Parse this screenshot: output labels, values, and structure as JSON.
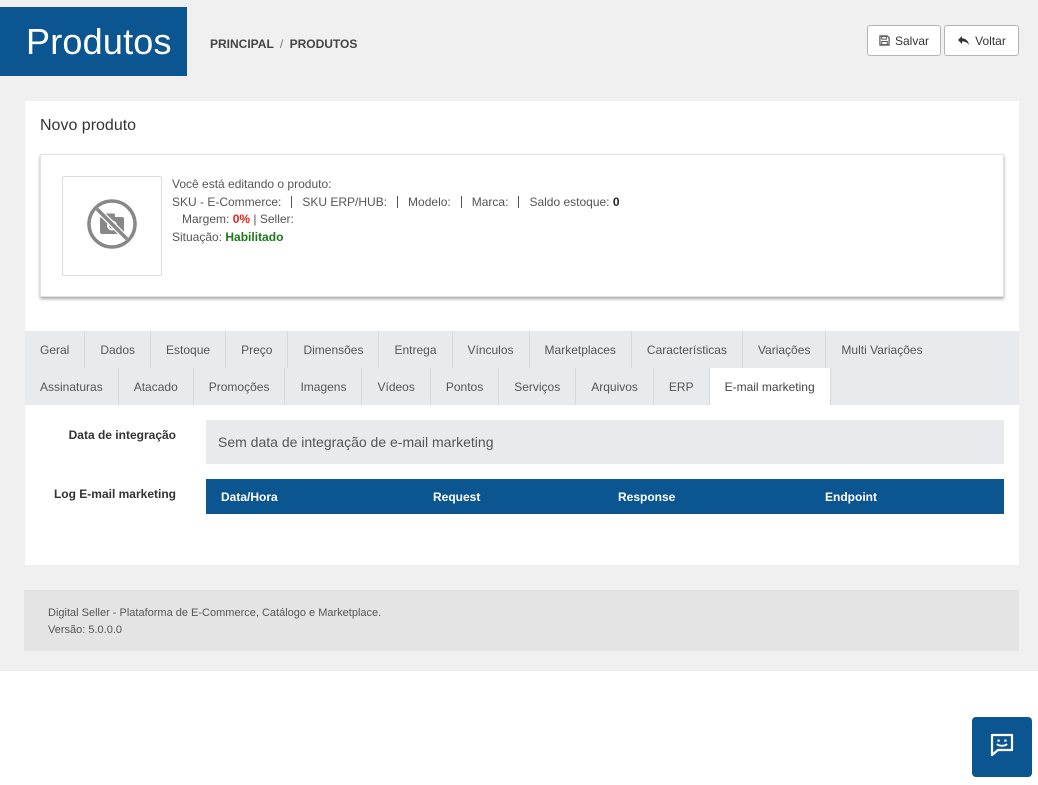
{
  "header": {
    "title": "Produtos",
    "breadcrumb": {
      "home": "PRINCIPAL",
      "separator": "/",
      "current": "PRODUTOS"
    },
    "buttons": {
      "save": "Salvar",
      "back": "Voltar"
    }
  },
  "card": {
    "title": "Novo produto",
    "product": {
      "editing_text": "Você está editando o produto:",
      "sku_ecommerce": "SKU - E-Commerce:",
      "sku_erp": "SKU ERP/HUB:",
      "modelo": "Modelo:",
      "marca": "Marca:",
      "saldo_label": "Saldo estoque:",
      "saldo_value": "0",
      "margem_label": "Margem:",
      "margem_value": "0%",
      "separator": "|",
      "seller_label": "Seller:",
      "situacao_label": "Situação:",
      "situacao_value": "Habilitado",
      "image_icon": "no-camera-icon"
    }
  },
  "tabs": {
    "row1": [
      "Geral",
      "Dados",
      "Estoque",
      "Preço",
      "Dimensões",
      "Entrega",
      "Vínculos",
      "Marketplaces",
      "Características",
      "Variações",
      "Multi Variações"
    ],
    "row2": [
      "Assinaturas",
      "Atacado",
      "Promoções",
      "Imagens",
      "Vídeos",
      "Pontos",
      "Serviços",
      "Arquivos",
      "ERP",
      "E-mail marketing"
    ],
    "active": "E-mail marketing"
  },
  "email_marketing": {
    "integration_label": "Data de integração",
    "integration_value": "Sem data de integração de e-mail marketing",
    "log_label": "Log E-mail marketing",
    "log_columns": [
      "Data/Hora",
      "Request",
      "Response",
      "Endpoint"
    ]
  },
  "footer": {
    "line1": "Digital Seller - Plataforma de E-Commerce, Catálogo e Marketplace.",
    "line2": "Versão: 5.0.0.0"
  },
  "colors": {
    "brand": "#0b5590",
    "danger": "#e2231a",
    "success": "#1a7a1a"
  },
  "chat": {
    "icon": "chat-smile-icon"
  }
}
